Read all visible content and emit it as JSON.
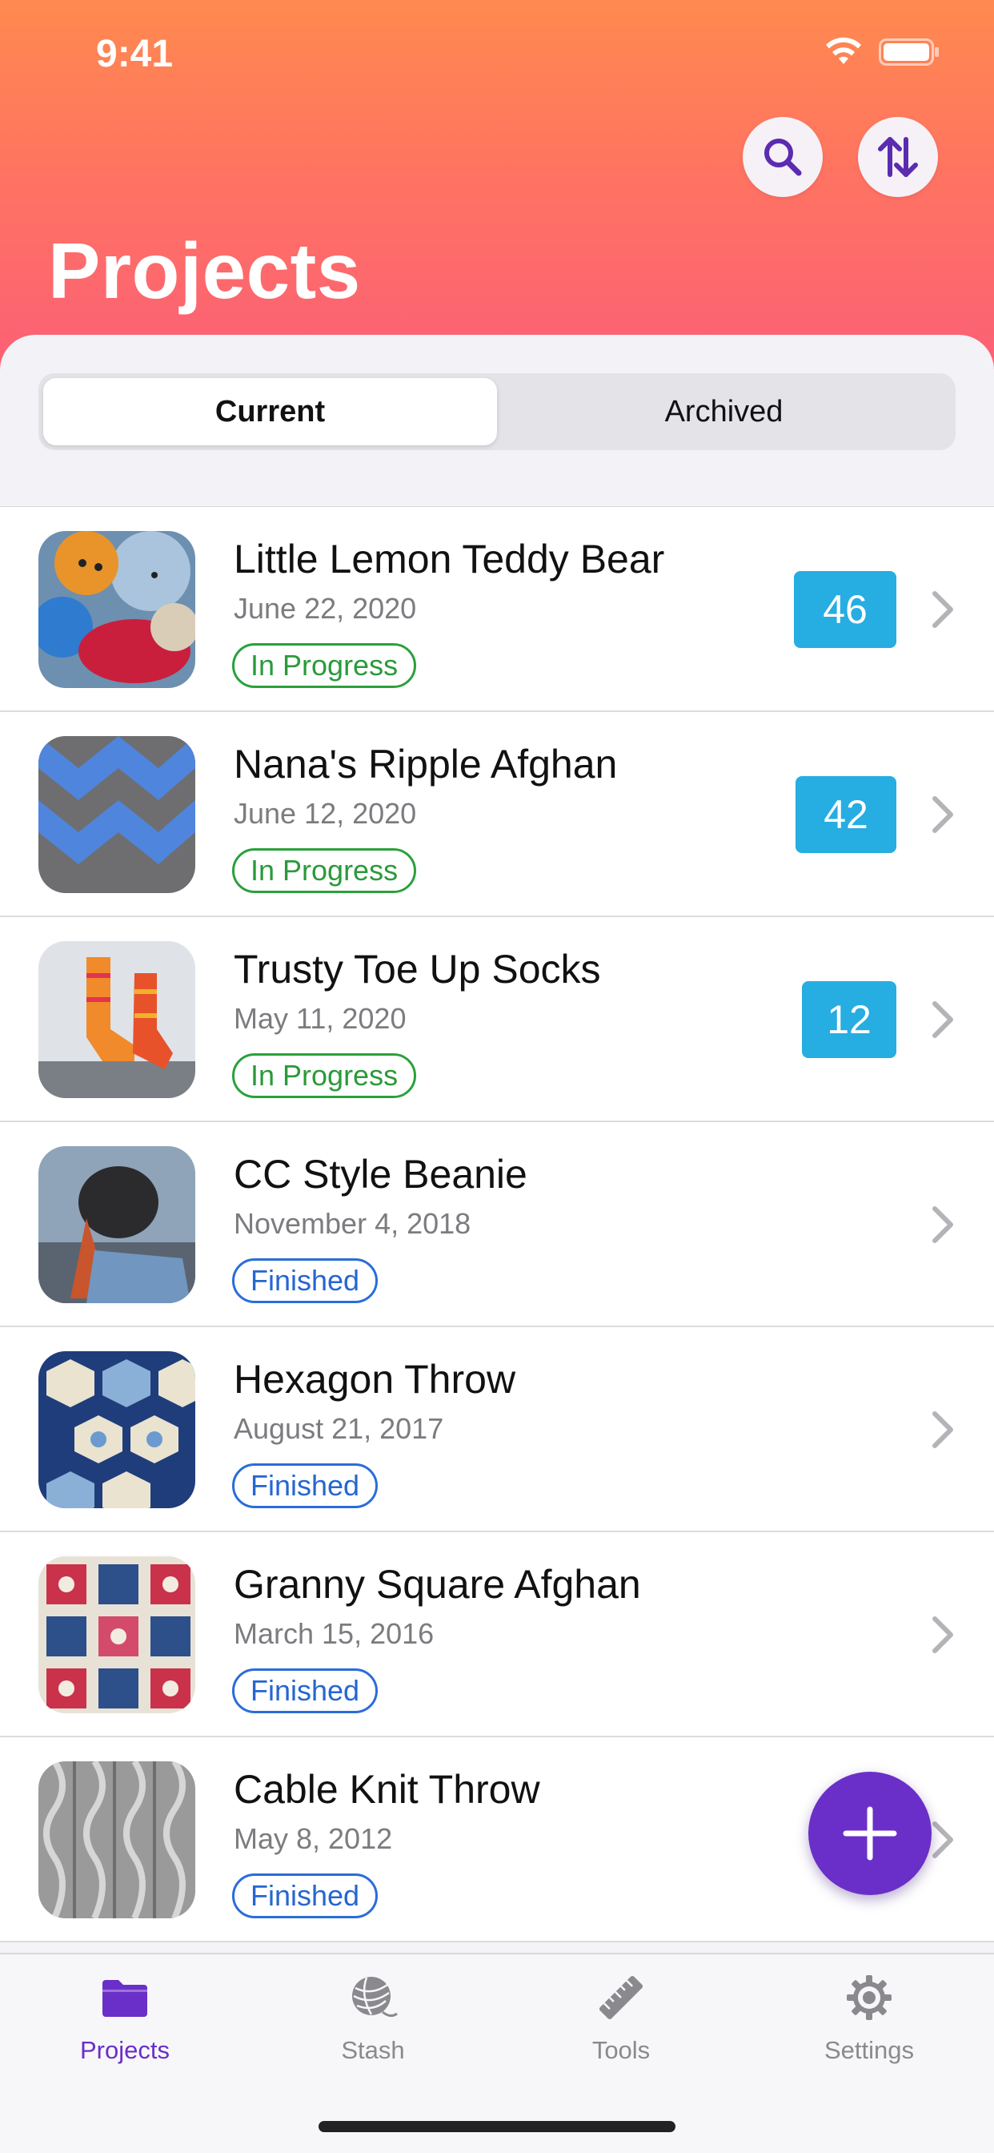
{
  "status_bar": {
    "time": "9:41"
  },
  "header": {
    "title": "Projects",
    "search_icon": "search-icon",
    "sort_icon": "sort-arrows-icon"
  },
  "segments": [
    {
      "label": "Current",
      "selected": true
    },
    {
      "label": "Archived",
      "selected": false
    }
  ],
  "projects": [
    {
      "title": "Little Lemon Teddy Bear",
      "date": "June 22, 2020",
      "status": "In Progress",
      "count": "46"
    },
    {
      "title": "Nana's Ripple Afghan",
      "date": "June 12, 2020",
      "status": "In Progress",
      "count": "42"
    },
    {
      "title": "Trusty Toe Up Socks",
      "date": "May 11, 2020",
      "status": "In Progress",
      "count": "12"
    },
    {
      "title": "CC Style Beanie",
      "date": "November 4, 2018",
      "status": "Finished"
    },
    {
      "title": "Hexagon Throw",
      "date": "August 21, 2017",
      "status": "Finished"
    },
    {
      "title": "Granny Square Afghan",
      "date": "March 15, 2016",
      "status": "Finished"
    },
    {
      "title": "Cable Knit Throw",
      "date": "May 8, 2012",
      "status": "Finished"
    }
  ],
  "fab": {
    "icon": "plus-icon"
  },
  "tab_bar": {
    "items": [
      {
        "label": "Projects",
        "icon": "folder-icon",
        "active": true
      },
      {
        "label": "Stash",
        "icon": "yarn-ball-icon",
        "active": false
      },
      {
        "label": "Tools",
        "icon": "ruler-icon",
        "active": false
      },
      {
        "label": "Settings",
        "icon": "gear-icon",
        "active": false
      }
    ]
  },
  "colors": {
    "accent": "#6a2fc8",
    "badge": "#26ade1",
    "in_progress": "#2aa13a",
    "finished": "#2a6dd9"
  }
}
